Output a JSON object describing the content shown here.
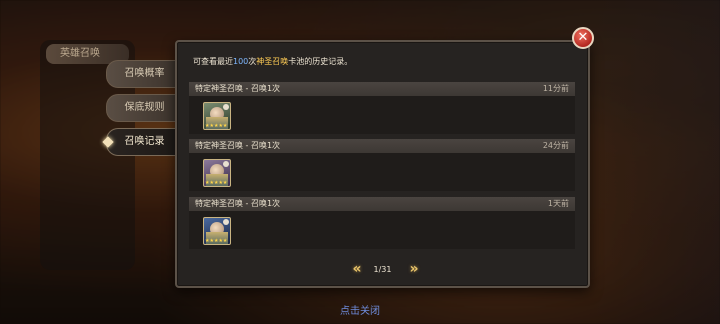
{
  "background": {
    "side_menu_title": "英雄召唤"
  },
  "tabs": [
    {
      "label": "召唤概率",
      "active": false
    },
    {
      "label": "保底规则",
      "active": false
    },
    {
      "label": "召唤记录",
      "active": true
    }
  ],
  "panel": {
    "desc_prefix": "可查看最近",
    "desc_count": "100",
    "desc_mid": "次",
    "desc_pool": "神圣召唤",
    "desc_suffix": "卡池的历史记录。"
  },
  "records": [
    {
      "title": "特定神圣召唤 - 召唤1次",
      "time": "11分前",
      "stars": "★★★★★"
    },
    {
      "title": "特定神圣召唤 - 召唤1次",
      "time": "24分前",
      "stars": "★★★★★"
    },
    {
      "title": "特定神圣召唤 - 召唤1次",
      "time": "1天前",
      "stars": "★★★★★"
    }
  ],
  "pager": {
    "page": "1/31",
    "prev": "«",
    "next": "»"
  },
  "close": {
    "symbol": "✕"
  },
  "tap_close_label": "点击关闭",
  "colors": {
    "accent_blue": "#7fb8ff",
    "accent_gold": "#ffcc55",
    "close_red": "#c0342a"
  }
}
